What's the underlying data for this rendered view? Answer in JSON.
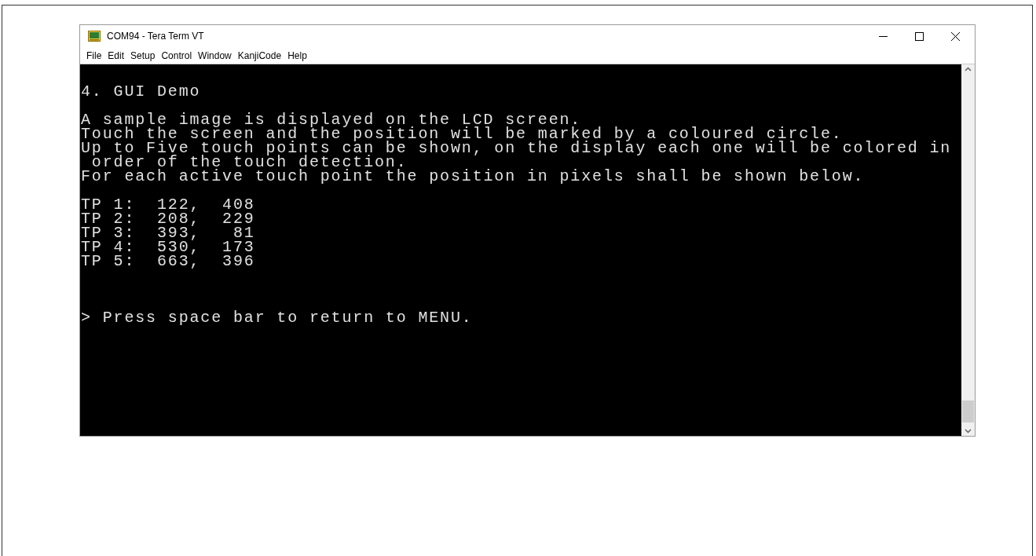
{
  "window": {
    "title": "COM94 - Tera Term VT"
  },
  "menu": [
    "File",
    "Edit",
    "Setup",
    "Control",
    "Window",
    "KanjiCode",
    "Help"
  ],
  "terminal": {
    "heading": "4. GUI Demo",
    "description": [
      "A sample image is displayed on the LCD screen.",
      "Touch the screen and the position will be marked by a coloured circle.",
      "Up to Five touch points can be shown, on the display each one will be colored in",
      " order of the touch detection.",
      "For each active touch point the position in pixels shall be shown below."
    ],
    "touch_points": [
      "TP 1:  122,  408",
      "TP 2:  208,  229",
      "TP 3:  393,   81",
      "TP 4:  530,  173",
      "TP 5:  663,  396"
    ],
    "prompt": "> Press space bar to return to MENU."
  }
}
